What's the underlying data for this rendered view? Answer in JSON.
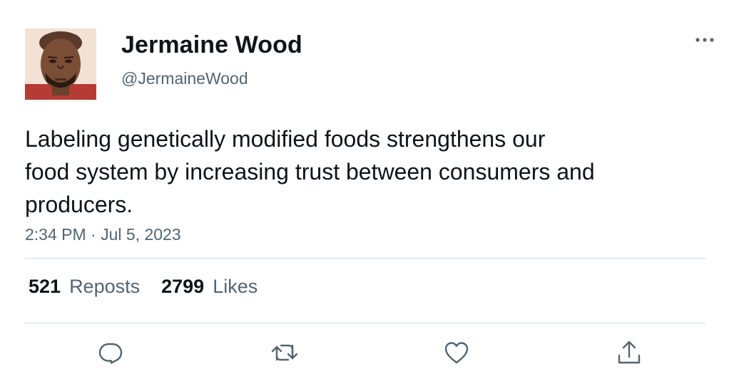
{
  "author": {
    "display_name": "Jermaine Wood",
    "handle": "@JermaineWood",
    "avatar_icon": "profile-photo"
  },
  "tweet": {
    "text_lines": [
      "Labeling genetically modified foods strengthens our",
      "food system by increasing trust between consumers and",
      "producers."
    ],
    "timestamp": "2:34 PM · Jul 5, 2023"
  },
  "stats": {
    "reposts_count": "521",
    "reposts_label": "Reposts",
    "likes_count": "2799",
    "likes_label": "Likes"
  },
  "actions": {
    "reply_icon": "reply-icon",
    "repost_icon": "repost-icon",
    "like_icon": "heart-icon",
    "share_icon": "share-icon",
    "more_icon": "more-icon"
  },
  "colors": {
    "text_primary": "#0f1419",
    "text_secondary": "#536471",
    "divider": "#cfd9de"
  }
}
